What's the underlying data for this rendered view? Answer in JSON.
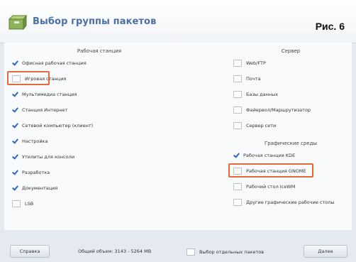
{
  "header": {
    "title": "Выбор группы пакетов",
    "figure_label": "Рис. 6"
  },
  "left_section": {
    "title": "Рабочая станция",
    "items": [
      {
        "label": "Офисная рабочая станция",
        "checked": true
      },
      {
        "label": "Игровая станция",
        "checked": false,
        "highlighted": true
      },
      {
        "label": "Мультимедиа станция",
        "checked": true
      },
      {
        "label": "Станция Интернет",
        "checked": true
      },
      {
        "label": "Сетевой компьютер (клиент)",
        "checked": true
      },
      {
        "label": "Настройка",
        "checked": true
      },
      {
        "label": "Утилиты для консоли",
        "checked": true
      },
      {
        "label": "Разработка",
        "checked": true
      },
      {
        "label": "Документация",
        "checked": true
      },
      {
        "label": "LSB",
        "checked": false
      }
    ]
  },
  "right_section": {
    "title": "Сервер",
    "items": [
      {
        "label": "Web/FTP",
        "checked": false
      },
      {
        "label": "Почта",
        "checked": false
      },
      {
        "label": "Базы данных",
        "checked": false
      },
      {
        "label": "Файервол/Маршрутизатор",
        "checked": false
      },
      {
        "label": "Сервер сети",
        "checked": false
      }
    ]
  },
  "graphics_section": {
    "title": "Графические среды",
    "items": [
      {
        "label": "Рабочая станция KDE",
        "checked": true
      },
      {
        "label": "Рабочая станция GNOME",
        "checked": false,
        "highlighted": true
      },
      {
        "label": "Рабочий стол IceWM",
        "checked": false
      },
      {
        "label": "Другие графические рабочие столы",
        "checked": false
      }
    ]
  },
  "footer": {
    "help_label": "Справка",
    "total_size": "Общий объем: 3143 - 5264 MB",
    "individual_label": "Выбор отдельных пакетов",
    "next_label": "Далее"
  },
  "colors": {
    "accent": "#2f66c5",
    "highlight": "#e36b3a",
    "title": "#4b6fa6"
  }
}
